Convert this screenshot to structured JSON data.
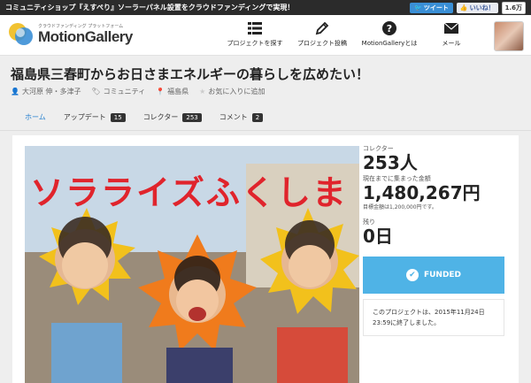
{
  "topbar": {
    "message": "コミュニティショップ『えすぺり』ソーラーパネル設置をクラウドファンディングで実現！",
    "tweet_label": "ツイート",
    "like_label": "いいね！",
    "like_count": "1.6万"
  },
  "header": {
    "tagline": "クラウドファンディング プラットフォーム",
    "logo_name": "MotionGallery",
    "nav": [
      {
        "label": "プロジェクトを探す",
        "icon": "list-icon"
      },
      {
        "label": "プロジェクト投稿",
        "icon": "pencil-icon"
      },
      {
        "label": "MotionGalleryとは",
        "icon": "question-icon"
      },
      {
        "label": "メール",
        "icon": "mail-icon"
      }
    ]
  },
  "project": {
    "title": "福島県三春町からお日さまエネルギーの暮らしを広めたい！",
    "owner": "大河原 伸・多津子",
    "category": "コミュニティ",
    "location": "福島県",
    "favorite": "お気に入りに追加",
    "banner_text": "ソラライズふくしま"
  },
  "tabs": [
    {
      "label": "ホーム",
      "badge": ""
    },
    {
      "label": "アップデート",
      "badge": "15"
    },
    {
      "label": "コレクター",
      "badge": "253"
    },
    {
      "label": "コメント",
      "badge": "2"
    }
  ],
  "stats": {
    "collectors_label": "コレクター",
    "collectors_value": "253人",
    "raised_label": "現在までに集まった金額",
    "raised_value": "1,480,267円",
    "goal_text": "目標金額は1,200,000円です。",
    "remaining_label": "残り",
    "remaining_value": "0日",
    "funded_label": "FUNDED",
    "end_note": "このプロジェクトは、2015年11月24日 23:59に終了しました。"
  },
  "colors": {
    "accent": "#2a82d0",
    "funded": "#4fb3e6",
    "banner_red": "#e0242c"
  }
}
